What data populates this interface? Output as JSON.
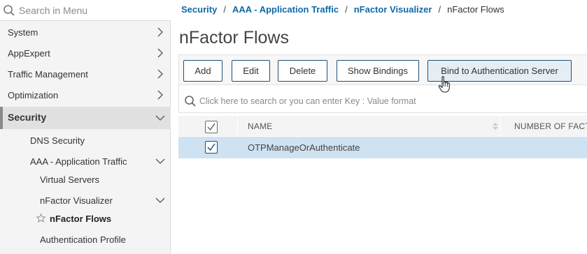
{
  "sidebar": {
    "search_placeholder": "Search in Menu",
    "items": [
      {
        "label": "System"
      },
      {
        "label": "AppExpert"
      },
      {
        "label": "Traffic Management"
      },
      {
        "label": "Optimization"
      },
      {
        "label": "Security"
      },
      {
        "label": "DNS Security"
      },
      {
        "label": "AAA - Application Traffic"
      },
      {
        "label": "Virtual Servers"
      },
      {
        "label": "nFactor Visualizer"
      },
      {
        "label": "nFactor Flows"
      },
      {
        "label": "Authentication Profile"
      }
    ]
  },
  "breadcrumb": {
    "items": [
      "Security",
      "AAA - Application Traffic",
      "nFactor Visualizer"
    ],
    "separator": "/",
    "current": "nFactor Flows"
  },
  "page": {
    "title": "nFactor Flows"
  },
  "toolbar": {
    "add": "Add",
    "edit": "Edit",
    "delete": "Delete",
    "show_bindings": "Show Bindings",
    "bind_auth_server": "Bind to Authentication Server"
  },
  "search": {
    "placeholder": "Click here to search or you can enter Key : Value format"
  },
  "table": {
    "columns": [
      "NAME",
      "NUMBER OF FACTO"
    ],
    "rows": [
      {
        "name": "OTPManageOrAuthenticate",
        "selected": true
      }
    ]
  },
  "colors": {
    "link": "#0e6aa5",
    "button_border": "#1e4f73",
    "row_selected": "#cfe2f1",
    "sidebar_bg": "#f4f4f4"
  }
}
